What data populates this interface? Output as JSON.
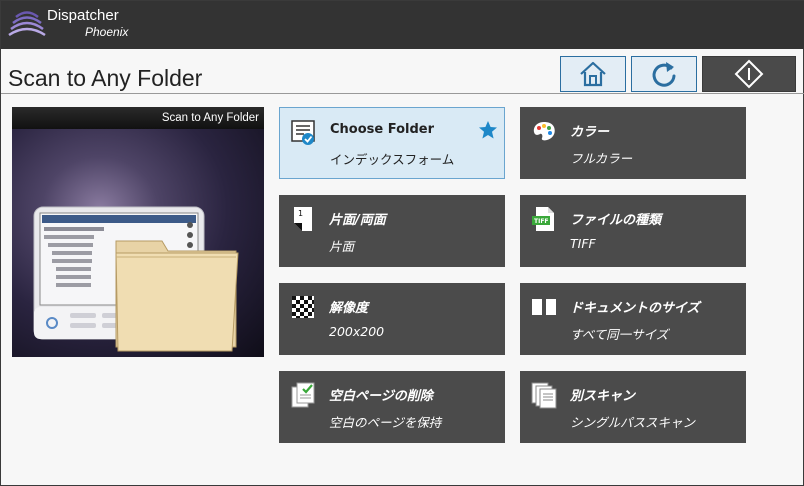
{
  "brand": {
    "name": "Dispatcher",
    "sub": "Phoenix"
  },
  "page": {
    "title": "Scan to Any Folder"
  },
  "nav": {
    "home_icon": "home-icon",
    "reset_icon": "refresh-icon",
    "start_icon": "start-diamond-icon"
  },
  "preview": {
    "title": "Scan to Any Folder"
  },
  "colors": {
    "topbar": "#333333",
    "tile": "#4b4b4b",
    "selected_tile": "#d9eaf5",
    "accent": "#1e88c8"
  },
  "tiles": [
    {
      "label": "Choose Folder",
      "value": "インデックスフォーム",
      "icon": "folder-list-icon",
      "selected": true,
      "favorite_icon": "star-icon"
    },
    {
      "label": "カラー",
      "value": "フルカラー",
      "icon": "palette-icon"
    },
    {
      "label": "片面/両面",
      "value": "片面",
      "icon": "page-one-sided-icon"
    },
    {
      "label": "ファイルの種類",
      "value": "TIFF",
      "icon": "tiff-file-icon"
    },
    {
      "label": "解像度",
      "value": "200x200",
      "icon": "resolution-checker-icon"
    },
    {
      "label": "ドキュメントのサイズ",
      "value": "すべて同一サイズ",
      "icon": "document-size-icon"
    },
    {
      "label": "空白ページの削除",
      "value": "空白のページを保持",
      "icon": "blank-page-check-icon"
    },
    {
      "label": "別スキャン",
      "value": "シングルパススキャン",
      "icon": "multi-page-scan-icon"
    }
  ]
}
